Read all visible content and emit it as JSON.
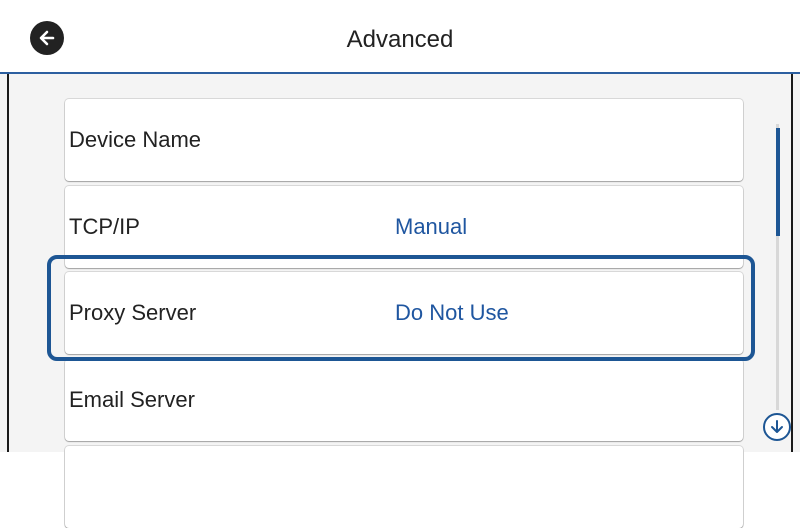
{
  "header": {
    "title": "Advanced",
    "back_icon": "back-arrow-icon"
  },
  "menu": {
    "items": [
      {
        "label": "Device Name",
        "value": ""
      },
      {
        "label": "TCP/IP",
        "value": "Manual"
      },
      {
        "label": "Proxy Server",
        "value": "Do Not Use",
        "selected": true
      },
      {
        "label": "Email Server",
        "value": ""
      },
      {
        "label": "",
        "value": ""
      }
    ]
  },
  "scrollbar": {
    "down_icon": "scroll-down-arrow-icon"
  },
  "colors": {
    "accent": "#1d5694",
    "value_text": "#1f56a0",
    "header_line": "#2c5fa0",
    "background": "#f4f4f4"
  }
}
